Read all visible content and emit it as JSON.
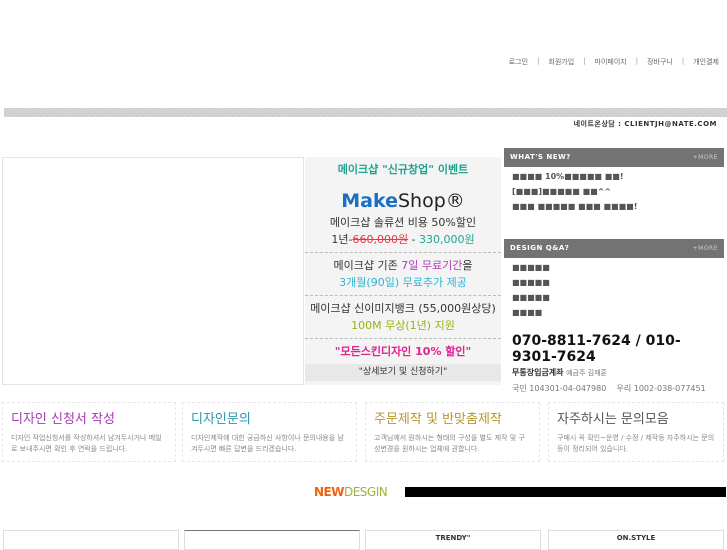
{
  "topnav": [
    "로그인",
    "회원가입",
    "마이페이지",
    "장바구니",
    "개인결제"
  ],
  "email": "네이트온상담 : CLIENTJH@NATE.COM",
  "promo": {
    "title": "메이크샵 \"신규창업\" 이벤트",
    "logo_a": "Make",
    "logo_b": "Shop®",
    "l1": "메이크샵 솔류션 비용 50%할인",
    "l2a": "1년-",
    "l2b": "660,000원",
    "l2c": " - ",
    "l2d": "330,000원",
    "l3a": "메이크샵 기존 ",
    "l3b": "7일 무료기간",
    "l3c": "을",
    "l4": "3개월(90일) 무료추가 제공",
    "l5": "메이크샵 신이미지뱅크 (55,000원상당)",
    "l6": "100M 무상(1년) 지원",
    "l7": "\"모든스킨디자인 10% 할인\"",
    "cta": "\"상세보기 및 신청하기\""
  },
  "whatsnew": {
    "title": "WHAT'S NEW?",
    "more": "+MORE",
    "items": [
      "■■■■ 10%■■■■■ ■■!",
      "[■■■]■■■■■ ■■^^",
      "■■■ ■■■■■ ■■■ ■■■■!"
    ]
  },
  "qa": {
    "title": "DESIGN Q&A?",
    "more": "+MORE",
    "items": [
      "■■■■■",
      "■■■■■",
      "■■■■■",
      "■■■■"
    ]
  },
  "contact": {
    "phone": "070-8811-7624 / 010-9301-7624",
    "bank_label": "무통장입금계좌",
    "holder": "예금주 김재훈",
    "acc1": "국민 104301-04-047980",
    "acc2": "우리 1002-038-077451"
  },
  "boxes": [
    {
      "title": "디자인 신청서 작성",
      "desc": "디자인 작업신청서를 작성하셔서 남겨두시거나 메일로 보내주시면 확인 후 연락을 드립니다.",
      "color": "#a23bb0"
    },
    {
      "title": "디자인문의",
      "desc": "디자인제작에 대한 궁금하신 사항이나 문의내용을 남겨두시면 빠른 답변을 드리겠습니다.",
      "color": "#2b97a6"
    },
    {
      "title": "주문제작 및 반맞춤제작",
      "desc": "고객님께서 원하시는 형태의 구성을 별도 제작 및 구성변경을 원하시는 업체에 권합니다.",
      "color": "#b8962e"
    },
    {
      "title": "자주하시는 문의모음",
      "desc": "구매시 꼭 확인~운영 / 수정 / 제작등 자주하시는 문의등이 정리되어 있습니다.",
      "color": "#555555"
    }
  ],
  "newdesign": {
    "a": "NEW",
    "b": "DESGIN"
  },
  "thumbs": [
    "",
    "",
    "TRENDY\"",
    "ON.STYLE"
  ]
}
